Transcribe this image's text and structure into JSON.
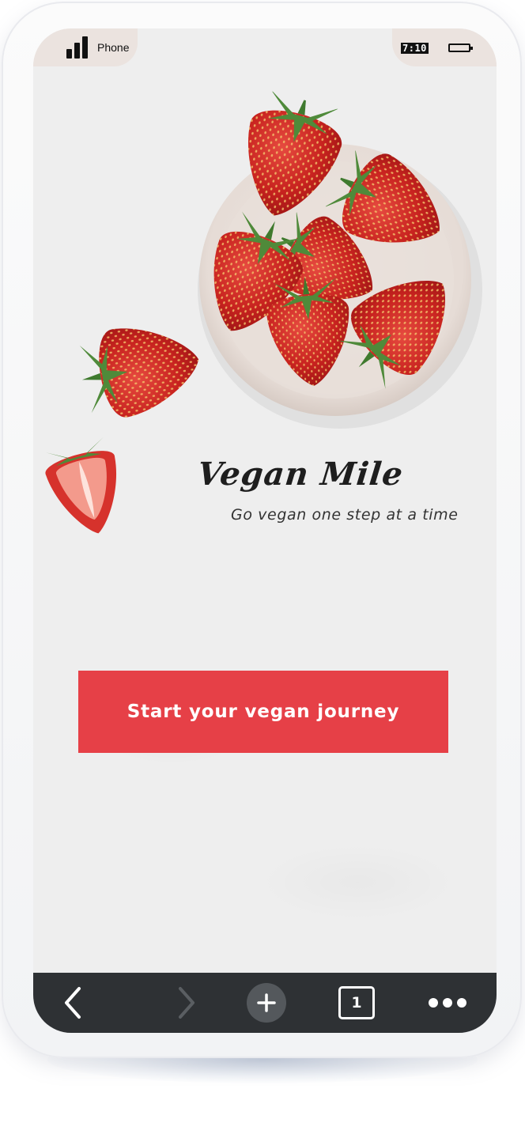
{
  "status_bar": {
    "carrier": "Phone",
    "time": "7:10"
  },
  "app": {
    "brand_title": "Vegan Mile",
    "tagline": "Go vegan one step at a time",
    "cta_label": "Start your vegan journey"
  },
  "toolbar": {
    "tab_count": "1",
    "icons": [
      "chevron-left-icon",
      "chevron-right-icon",
      "plus-icon",
      "tabs-icon",
      "more-dots-icon"
    ]
  },
  "colors": {
    "accent": "#e64047",
    "toolbar_bg": "#2e3134",
    "screen_bg": "#eeeeee",
    "status_bg": "#ebe3df"
  }
}
